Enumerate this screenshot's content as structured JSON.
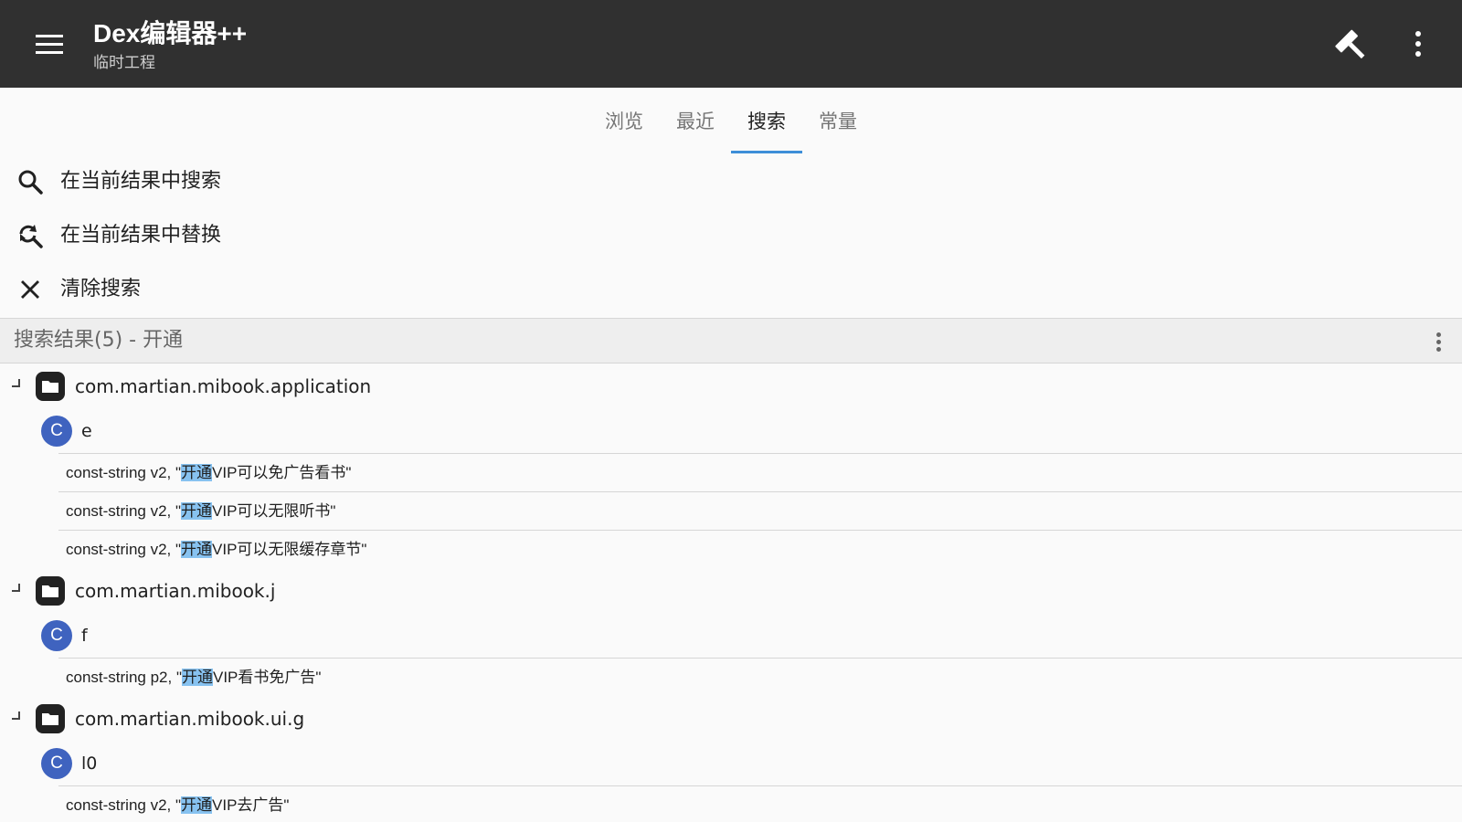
{
  "appbar": {
    "title": "Dex编辑器++",
    "subtitle": "临时工程",
    "menu_icon": "menu-icon",
    "build_icon": "hammer-icon",
    "overflow_icon": "more-vert-icon"
  },
  "tabs": [
    {
      "label": "浏览",
      "active": false
    },
    {
      "label": "最近",
      "active": false
    },
    {
      "label": "搜索",
      "active": true
    },
    {
      "label": "常量",
      "active": false
    }
  ],
  "actions": {
    "search_in_results": "在当前结果中搜索",
    "replace_in_results": "在当前结果中替换",
    "clear_search": "清除搜索"
  },
  "results": {
    "header": "搜索结果(5) - 开通",
    "groups": [
      {
        "package": "com.martian.mibook.application",
        "class_badge": "C",
        "class_name": "e",
        "items": [
          {
            "prefix": "const-string v2, \"",
            "match": "开通",
            "suffix": "VIP可以免广告看书\""
          },
          {
            "prefix": "const-string v2, \"",
            "match": "开通",
            "suffix": "VIP可以无限听书\""
          },
          {
            "prefix": "const-string v2, \"",
            "match": "开通",
            "suffix": "VIP可以无限缓存章节\""
          }
        ]
      },
      {
        "package": "com.martian.mibook.j",
        "class_badge": "C",
        "class_name": "f",
        "items": [
          {
            "prefix": "const-string p2, \"",
            "match": "开通",
            "suffix": "VIP看书免广告\""
          }
        ]
      },
      {
        "package": "com.martian.mibook.ui.g",
        "class_badge": "C",
        "class_name": "l0",
        "items": [
          {
            "prefix": "const-string v2, \"",
            "match": "开通",
            "suffix": "VIP去广告\""
          }
        ]
      }
    ]
  },
  "colors": {
    "appbar": "#303030",
    "tab_indicator": "#3d8ed8",
    "class_badge": "#3f63bf",
    "match_highlight": "#87c2f0"
  }
}
